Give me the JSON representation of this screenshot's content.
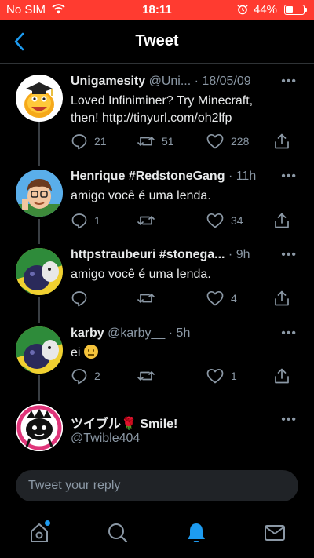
{
  "status_bar": {
    "carrier": "No SIM",
    "time": "18:11",
    "battery_percent": "44%",
    "battery_level": 0.44,
    "background": "#ff3b30"
  },
  "header": {
    "title": "Tweet"
  },
  "tweets": [
    {
      "name": "Unigamesity",
      "handle": "@Uni...",
      "time": "· 18/05/09",
      "text_line1": "Loved Infiniminer? Try Minecraft,",
      "text_line2": "then!  http://tinyurl.com/oh2lfp",
      "replies": "21",
      "retweets": "51",
      "likes": "228"
    },
    {
      "name": "Henrique #RedstoneGang",
      "handle": "",
      "time": "· 11h",
      "text": "amigo você é uma lenda.",
      "replies": "1",
      "retweets": "",
      "likes": "34"
    },
    {
      "name": "httpstraubeuri #stonega...",
      "handle": "",
      "time": "· 9h",
      "text": "amigo você é uma lenda.",
      "replies": "",
      "retweets": "",
      "likes": "4"
    },
    {
      "name": "karby",
      "handle": "@karby__",
      "time": "· 5h",
      "text": "ei",
      "replies": "2",
      "retweets": "",
      "likes": "1"
    },
    {
      "name": "ツイブル🌹 Smile!",
      "handle": "@Twible404"
    }
  ],
  "reply": {
    "placeholder": "Tweet your reply"
  },
  "tabs": [
    "home-icon",
    "search-icon",
    "notifications-icon",
    "messages-icon"
  ],
  "colors": {
    "accent": "#1d9bf0",
    "text_secondary": "#8b98a5",
    "background": "#000000"
  }
}
